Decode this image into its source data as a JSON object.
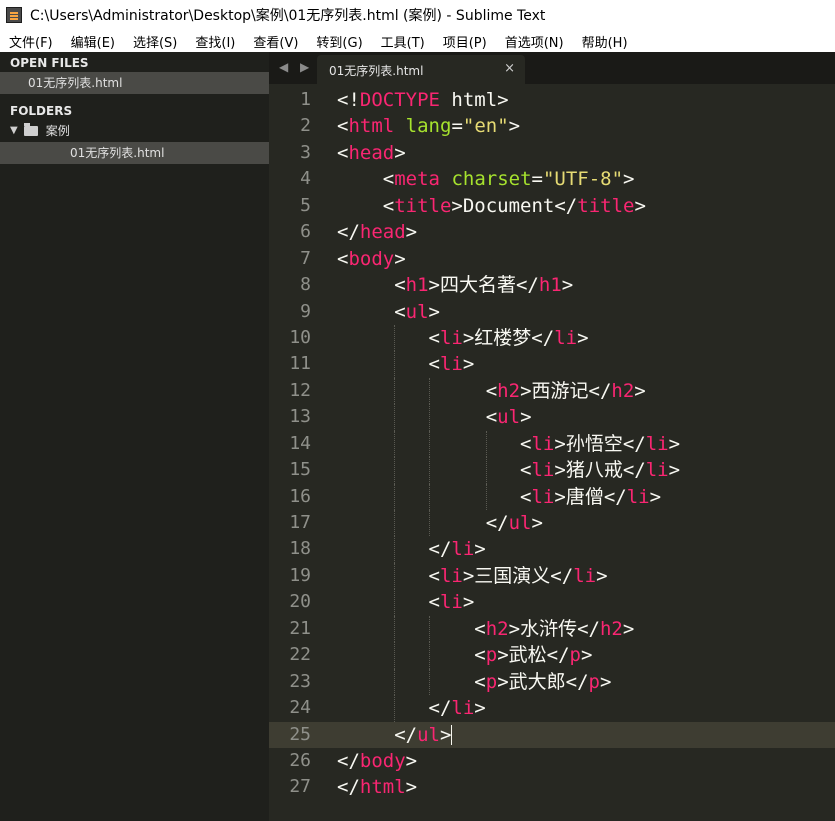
{
  "window": {
    "title": "C:\\Users\\Administrator\\Desktop\\案例\\01无序列表.html (案例) - Sublime Text"
  },
  "menu": [
    "文件(F)",
    "编辑(E)",
    "选择(S)",
    "查找(I)",
    "查看(V)",
    "转到(G)",
    "工具(T)",
    "项目(P)",
    "首选项(N)",
    "帮助(H)"
  ],
  "sidebar": {
    "open_files_label": "OPEN FILES",
    "open_file": "01无序列表.html",
    "folders_label": "FOLDERS",
    "folder_name": "案例",
    "folder_file": "01无序列表.html"
  },
  "tab": {
    "label": "01无序列表.html",
    "close": "×",
    "arrows": "◀ ▶"
  },
  "colors": {
    "background": "#272822",
    "tag": "#f92672",
    "attribute": "#a6e22e",
    "string": "#e6db74",
    "text": "#f8f8f2",
    "line_number": "#8f908a"
  },
  "editor": {
    "current_line": 25,
    "lines": [
      {
        "n": "1",
        "indent": 0,
        "tok": [
          [
            "p",
            "<!"
          ],
          [
            "t",
            "DOCTYPE"
          ],
          [
            "p",
            " html>"
          ]
        ]
      },
      {
        "n": "2",
        "indent": 0,
        "tok": [
          [
            "p",
            "<"
          ],
          [
            "t",
            "html"
          ],
          [
            "p",
            " "
          ],
          [
            "a",
            "lang"
          ],
          [
            "p",
            "="
          ],
          [
            "s",
            "\"en\""
          ],
          [
            "p",
            ">"
          ]
        ]
      },
      {
        "n": "3",
        "indent": 0,
        "tok": [
          [
            "p",
            "<"
          ],
          [
            "t",
            "head"
          ],
          [
            "p",
            ">"
          ]
        ]
      },
      {
        "n": "4",
        "indent": 4,
        "tok": [
          [
            "p",
            "<"
          ],
          [
            "t",
            "meta"
          ],
          [
            "p",
            " "
          ],
          [
            "a",
            "charset"
          ],
          [
            "p",
            "="
          ],
          [
            "s",
            "\"UTF-8\""
          ],
          [
            "p",
            ">"
          ]
        ]
      },
      {
        "n": "5",
        "indent": 4,
        "tok": [
          [
            "p",
            "<"
          ],
          [
            "t",
            "title"
          ],
          [
            "p",
            ">Document</"
          ],
          [
            "t",
            "title"
          ],
          [
            "p",
            ">"
          ]
        ]
      },
      {
        "n": "6",
        "indent": 0,
        "tok": [
          [
            "p",
            "</"
          ],
          [
            "t",
            "head"
          ],
          [
            "p",
            ">"
          ]
        ]
      },
      {
        "n": "7",
        "indent": 0,
        "tok": [
          [
            "p",
            "<"
          ],
          [
            "t",
            "body"
          ],
          [
            "p",
            ">"
          ]
        ]
      },
      {
        "n": "8",
        "indent": 5,
        "tok": [
          [
            "p",
            "<"
          ],
          [
            "t",
            "h1"
          ],
          [
            "p",
            ">四大名著</"
          ],
          [
            "t",
            "h1"
          ],
          [
            "p",
            ">"
          ]
        ]
      },
      {
        "n": "9",
        "indent": 5,
        "tok": [
          [
            "p",
            "<"
          ],
          [
            "t",
            "ul"
          ],
          [
            "p",
            ">"
          ]
        ]
      },
      {
        "n": "10",
        "indent": 8,
        "tok": [
          [
            "p",
            "<"
          ],
          [
            "t",
            "li"
          ],
          [
            "p",
            ">红楼梦</"
          ],
          [
            "t",
            "li"
          ],
          [
            "p",
            ">"
          ]
        ]
      },
      {
        "n": "11",
        "indent": 8,
        "tok": [
          [
            "p",
            "<"
          ],
          [
            "t",
            "li"
          ],
          [
            "p",
            ">"
          ]
        ]
      },
      {
        "n": "12",
        "indent": 13,
        "tok": [
          [
            "p",
            "<"
          ],
          [
            "t",
            "h2"
          ],
          [
            "p",
            ">西游记</"
          ],
          [
            "t",
            "h2"
          ],
          [
            "p",
            ">"
          ]
        ]
      },
      {
        "n": "13",
        "indent": 13,
        "tok": [
          [
            "p",
            "<"
          ],
          [
            "t",
            "ul"
          ],
          [
            "p",
            ">"
          ]
        ]
      },
      {
        "n": "14",
        "indent": 16,
        "tok": [
          [
            "p",
            "<"
          ],
          [
            "t",
            "li"
          ],
          [
            "p",
            ">孙悟空</"
          ],
          [
            "t",
            "li"
          ],
          [
            "p",
            ">"
          ]
        ]
      },
      {
        "n": "15",
        "indent": 16,
        "tok": [
          [
            "p",
            "<"
          ],
          [
            "t",
            "li"
          ],
          [
            "p",
            ">猪八戒</"
          ],
          [
            "t",
            "li"
          ],
          [
            "p",
            ">"
          ]
        ]
      },
      {
        "n": "16",
        "indent": 16,
        "tok": [
          [
            "p",
            "<"
          ],
          [
            "t",
            "li"
          ],
          [
            "p",
            ">唐僧</"
          ],
          [
            "t",
            "li"
          ],
          [
            "p",
            ">"
          ]
        ]
      },
      {
        "n": "17",
        "indent": 13,
        "tok": [
          [
            "p",
            "</"
          ],
          [
            "t",
            "ul"
          ],
          [
            "p",
            ">"
          ]
        ]
      },
      {
        "n": "18",
        "indent": 8,
        "tok": [
          [
            "p",
            "</"
          ],
          [
            "t",
            "li"
          ],
          [
            "p",
            ">"
          ]
        ]
      },
      {
        "n": "19",
        "indent": 8,
        "tok": [
          [
            "p",
            "<"
          ],
          [
            "t",
            "li"
          ],
          [
            "p",
            ">三国演义</"
          ],
          [
            "t",
            "li"
          ],
          [
            "p",
            ">"
          ]
        ]
      },
      {
        "n": "20",
        "indent": 8,
        "tok": [
          [
            "p",
            "<"
          ],
          [
            "t",
            "li"
          ],
          [
            "p",
            ">"
          ]
        ]
      },
      {
        "n": "21",
        "indent": 12,
        "tok": [
          [
            "p",
            "<"
          ],
          [
            "t",
            "h2"
          ],
          [
            "p",
            ">水浒传</"
          ],
          [
            "t",
            "h2"
          ],
          [
            "p",
            ">"
          ]
        ]
      },
      {
        "n": "22",
        "indent": 12,
        "tok": [
          [
            "p",
            "<"
          ],
          [
            "t",
            "p"
          ],
          [
            "p",
            ">武松</"
          ],
          [
            "t",
            "p"
          ],
          [
            "p",
            ">"
          ]
        ]
      },
      {
        "n": "23",
        "indent": 12,
        "tok": [
          [
            "p",
            "<"
          ],
          [
            "t",
            "p"
          ],
          [
            "p",
            ">武大郎</"
          ],
          [
            "t",
            "p"
          ],
          [
            "p",
            ">"
          ]
        ]
      },
      {
        "n": "24",
        "indent": 8,
        "tok": [
          [
            "p",
            "</"
          ],
          [
            "t",
            "li"
          ],
          [
            "p",
            ">"
          ]
        ]
      },
      {
        "n": "25",
        "indent": 5,
        "tok": [
          [
            "p",
            "</"
          ],
          [
            "t",
            "ul"
          ],
          [
            "p",
            ">"
          ]
        ]
      },
      {
        "n": "26",
        "indent": 0,
        "tok": [
          [
            "p",
            "</"
          ],
          [
            "t",
            "body"
          ],
          [
            "p",
            ">"
          ]
        ]
      },
      {
        "n": "27",
        "indent": 0,
        "tok": [
          [
            "p",
            "</"
          ],
          [
            "t",
            "html"
          ],
          [
            "p",
            ">"
          ]
        ]
      }
    ]
  }
}
